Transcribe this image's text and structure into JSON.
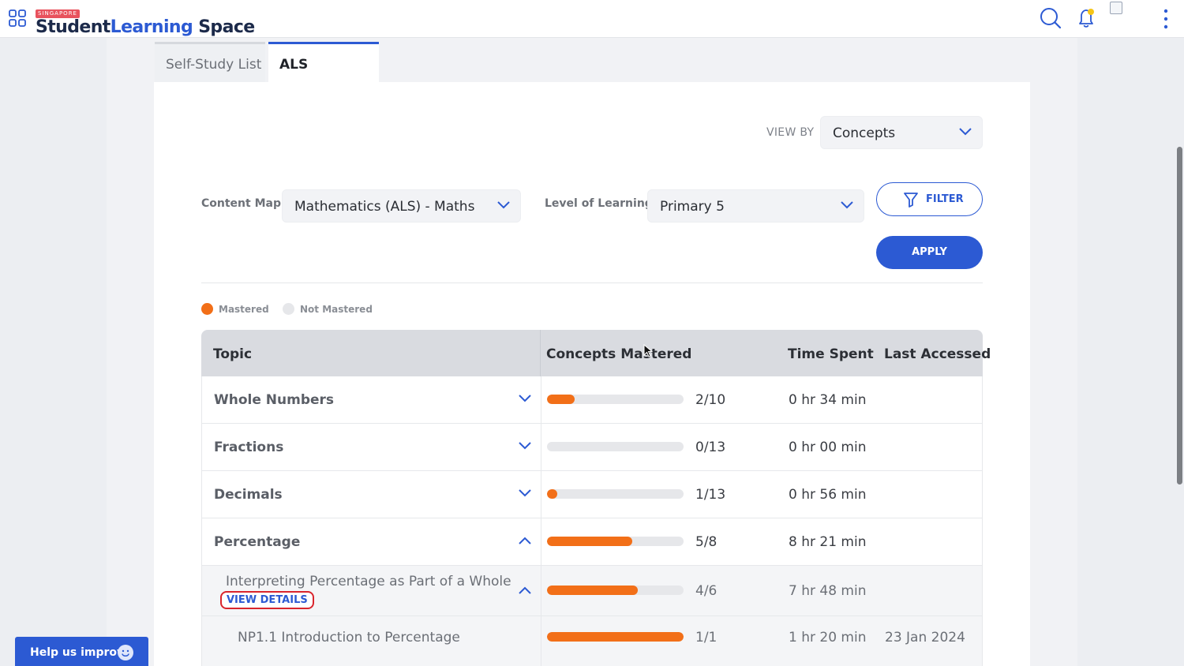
{
  "header": {
    "logo_tag": "SINGAPORE",
    "logo_word1": "Student",
    "logo_word2": "Learning",
    "logo_word3": "Space",
    "icons": [
      "apps-grid-icon",
      "search-icon",
      "bell-icon",
      "profile-image-icon",
      "more-vertical-icon"
    ]
  },
  "tabs": [
    {
      "label": "Self-Study List",
      "active": false
    },
    {
      "label": "ALS",
      "active": true
    }
  ],
  "view_by": {
    "label": "VIEW BY",
    "value": "Concepts"
  },
  "filters": {
    "content_map_label": "Content Map",
    "content_map_value": "Mathematics (ALS) - Maths",
    "level_label": "Level of Learning",
    "level_value": "Primary 5",
    "filter_button": "FILTER",
    "apply_button": "APPLY"
  },
  "legend": {
    "mastered": "Mastered",
    "not_mastered": "Not Mastered"
  },
  "colors": {
    "accent": "#2c5ad3",
    "mastered": "#f26f18",
    "not_mastered": "#e6e7ea",
    "highlight": "#d9252d"
  },
  "table": {
    "headers": {
      "topic": "Topic",
      "concepts": "Concepts Mastered",
      "time": "Time Spent",
      "last": "Last Accessed"
    },
    "rows": [
      {
        "topic": "Whole Numbers",
        "count": "2/10",
        "progress": 0.2,
        "time": "0 hr 34 min",
        "last": "",
        "expanded": false
      },
      {
        "topic": "Fractions",
        "count": "0/13",
        "progress": 0,
        "time": "0 hr 00 min",
        "last": "",
        "expanded": false
      },
      {
        "topic": "Decimals",
        "count": "1/13",
        "progress": 0.077,
        "time": "0 hr 56 min",
        "last": "",
        "expanded": false
      },
      {
        "topic": "Percentage",
        "count": "5/8",
        "progress": 0.625,
        "time": "8 hr 21 min",
        "last": "",
        "expanded": true
      }
    ],
    "subtopic": {
      "title": "Interpreting Percentage as Part of a Whole",
      "view_details": "VIEW DETAILS",
      "count": "4/6",
      "progress": 0.667,
      "time": "7 hr 48 min",
      "last": ""
    },
    "concept": {
      "title": "NP1.1 Introduction to Percentage",
      "count": "1/1",
      "progress": 1.0,
      "time": "1 hr 20 min",
      "last": "23 Jan 2024"
    }
  },
  "help": {
    "label": "Help us improve"
  }
}
